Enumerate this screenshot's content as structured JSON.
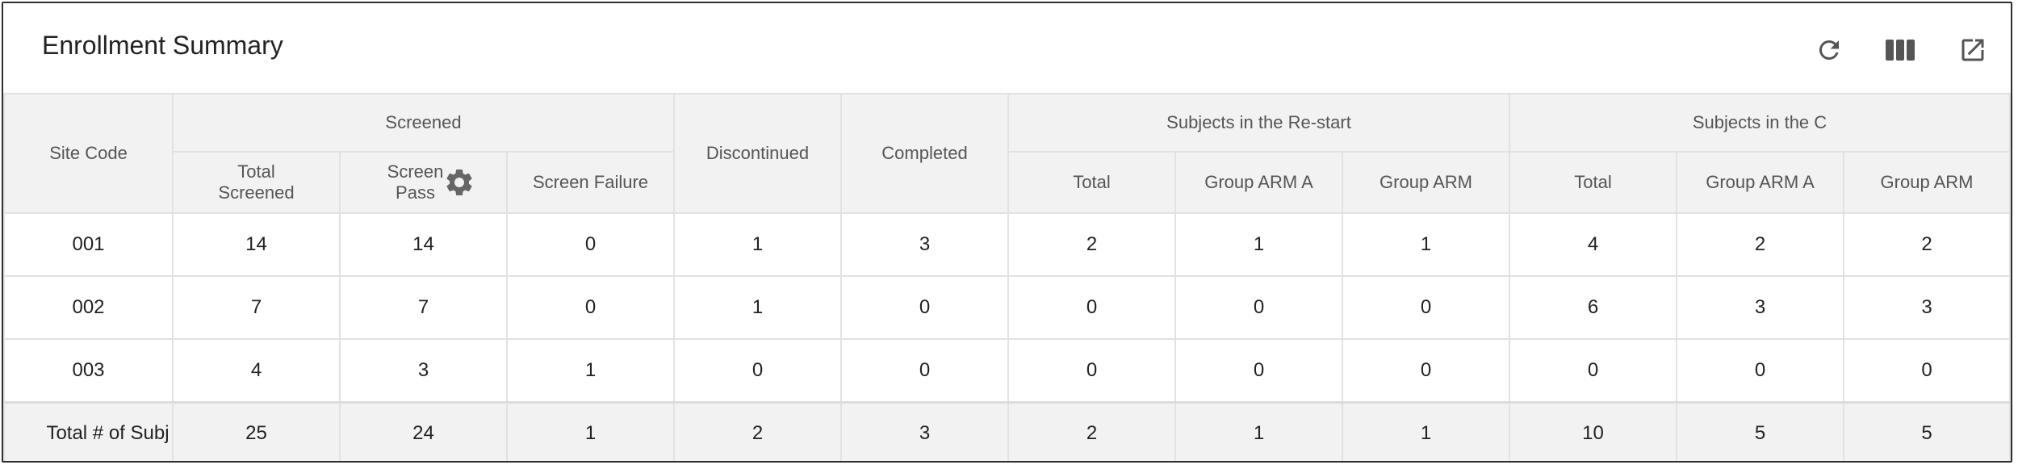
{
  "panel": {
    "title": "Enrollment Summary",
    "toolbar": {
      "refresh_icon": "refresh-icon",
      "columns_icon": "columns-icon",
      "export_icon": "open-external-icon"
    }
  },
  "table": {
    "headers": {
      "site_code": "Site Code",
      "screened": "Screened",
      "total_screened": "Total Screened",
      "screen_pass": "Screen Pass",
      "screen_failure": "Screen Failure",
      "discontinued": "Discontinued",
      "completed": "Completed",
      "restart_group": "Subjects in the Re-start",
      "restart_total": "Total",
      "restart_arm_a": "Group ARM A",
      "restart_arm": "Group ARM",
      "c_group": "Subjects in the C",
      "c_total": "Total",
      "c_arm_a": "Group ARM A",
      "c_arm": "Group ARM"
    },
    "rows": [
      [
        "001",
        "14",
        "14",
        "0",
        "1",
        "3",
        "2",
        "1",
        "1",
        "4",
        "2",
        "2"
      ],
      [
        "002",
        "7",
        "7",
        "0",
        "1",
        "0",
        "0",
        "0",
        "0",
        "6",
        "3",
        "3"
      ],
      [
        "003",
        "4",
        "3",
        "1",
        "0",
        "0",
        "0",
        "0",
        "0",
        "0",
        "0",
        "0"
      ]
    ],
    "total_row": [
      "Total # of Subj",
      "25",
      "24",
      "1",
      "2",
      "3",
      "2",
      "1",
      "1",
      "10",
      "5",
      "5"
    ]
  },
  "colors": {
    "header_bg": "#f2f2f2",
    "border": "#e2e2e2",
    "frame": "#2e2e2e",
    "icon": "#555555"
  }
}
